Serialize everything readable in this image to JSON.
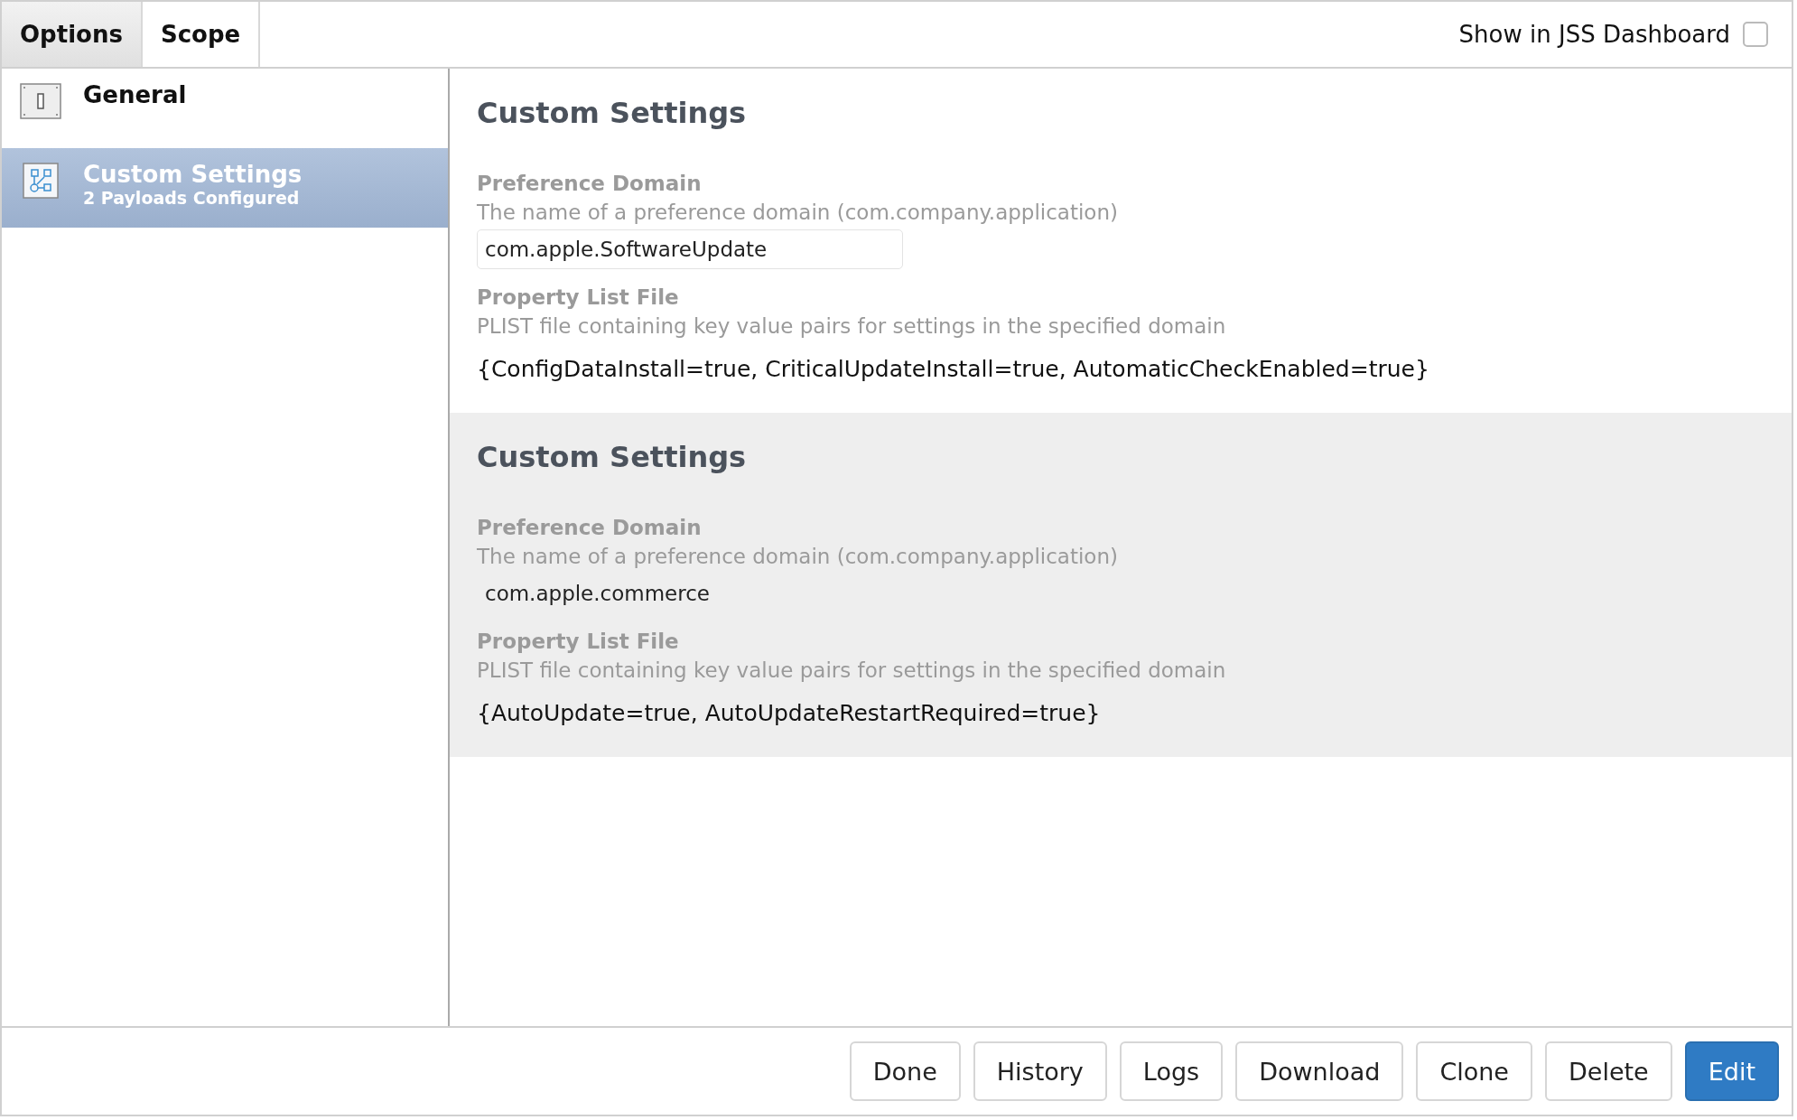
{
  "tabs": [
    {
      "label": "Options",
      "selected": true
    },
    {
      "label": "Scope",
      "selected": false
    }
  ],
  "dashboard_toggle": {
    "label": "Show in JSS Dashboard",
    "checked": false
  },
  "sidebar": {
    "items": [
      {
        "kind": "switch",
        "title": "General",
        "selected": false
      },
      {
        "kind": "diagram",
        "title": "Custom Settings",
        "subtitle": "2 Payloads Configured",
        "selected": true
      }
    ]
  },
  "payloads": [
    {
      "title": "Custom Settings",
      "highlighted": false,
      "domain_label": "Preference Domain",
      "domain_hint": "The name of a preference domain (com.company.application)",
      "domain_value": "com.apple.SoftwareUpdate",
      "domain_boxed": true,
      "plist_label": "Property List File",
      "plist_hint": "PLIST file containing key value pairs for settings in the specified domain",
      "plist_value": "{ConfigDataInstall=true, CriticalUpdateInstall=true, AutomaticCheckEnabled=true}"
    },
    {
      "title": "Custom Settings",
      "highlighted": true,
      "domain_label": "Preference Domain",
      "domain_hint": "The name of a preference domain (com.company.application)",
      "domain_value": "com.apple.commerce",
      "domain_boxed": false,
      "plist_label": "Property List File",
      "plist_hint": "PLIST file containing key value pairs for settings in the specified domain",
      "plist_value": "{AutoUpdate=true, AutoUpdateRestartRequired=true}"
    }
  ],
  "buttons": [
    {
      "label": "Done",
      "primary": false
    },
    {
      "label": "History",
      "primary": false
    },
    {
      "label": "Logs",
      "primary": false
    },
    {
      "label": "Download",
      "primary": false
    },
    {
      "label": "Clone",
      "primary": false
    },
    {
      "label": "Delete",
      "primary": false
    },
    {
      "label": "Edit",
      "primary": true
    }
  ]
}
